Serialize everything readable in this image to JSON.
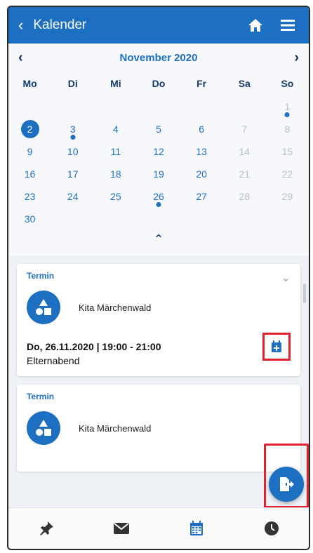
{
  "topbar": {
    "back_glyph": "‹",
    "title": "Kalender"
  },
  "calendar": {
    "month": "November 2020",
    "prev_glyph": "‹",
    "next_glyph": "›",
    "weekdays": [
      "Mo",
      "Di",
      "Mi",
      "Do",
      "Fr",
      "Sa",
      "So"
    ],
    "weeks": [
      [
        "",
        "",
        "",
        "",
        "",
        "",
        "1"
      ],
      [
        "2",
        "3",
        "4",
        "5",
        "6",
        "7",
        "8"
      ],
      [
        "9",
        "10",
        "11",
        "12",
        "13",
        "14",
        "15"
      ],
      [
        "16",
        "17",
        "18",
        "19",
        "20",
        "21",
        "22"
      ],
      [
        "23",
        "24",
        "25",
        "26",
        "27",
        "28",
        "29"
      ],
      [
        "30",
        "",
        "",
        "",
        "",
        "",
        ""
      ]
    ],
    "selected_day": "2",
    "event_days": [
      "1",
      "3",
      "26"
    ],
    "collapse_glyph": "⌃"
  },
  "events": [
    {
      "tag": "Termin",
      "org": "Kita Märchenwald",
      "when": "Do, 26.11.2020 | 19:00 - 21:00",
      "what": "Elternabend"
    },
    {
      "tag": "Termin",
      "org": "Kita Märchenwald"
    }
  ],
  "colors": {
    "primary": "#1d6fc2",
    "highlight": "#e0222e"
  },
  "icons": {
    "home": "home-icon",
    "menu": "hamburger-menu-icon",
    "calendar_add": "calendar-add-icon",
    "export": "file-export-icon",
    "nav": [
      "pin-icon",
      "mail-icon",
      "calendar-icon",
      "clock-icon"
    ]
  }
}
